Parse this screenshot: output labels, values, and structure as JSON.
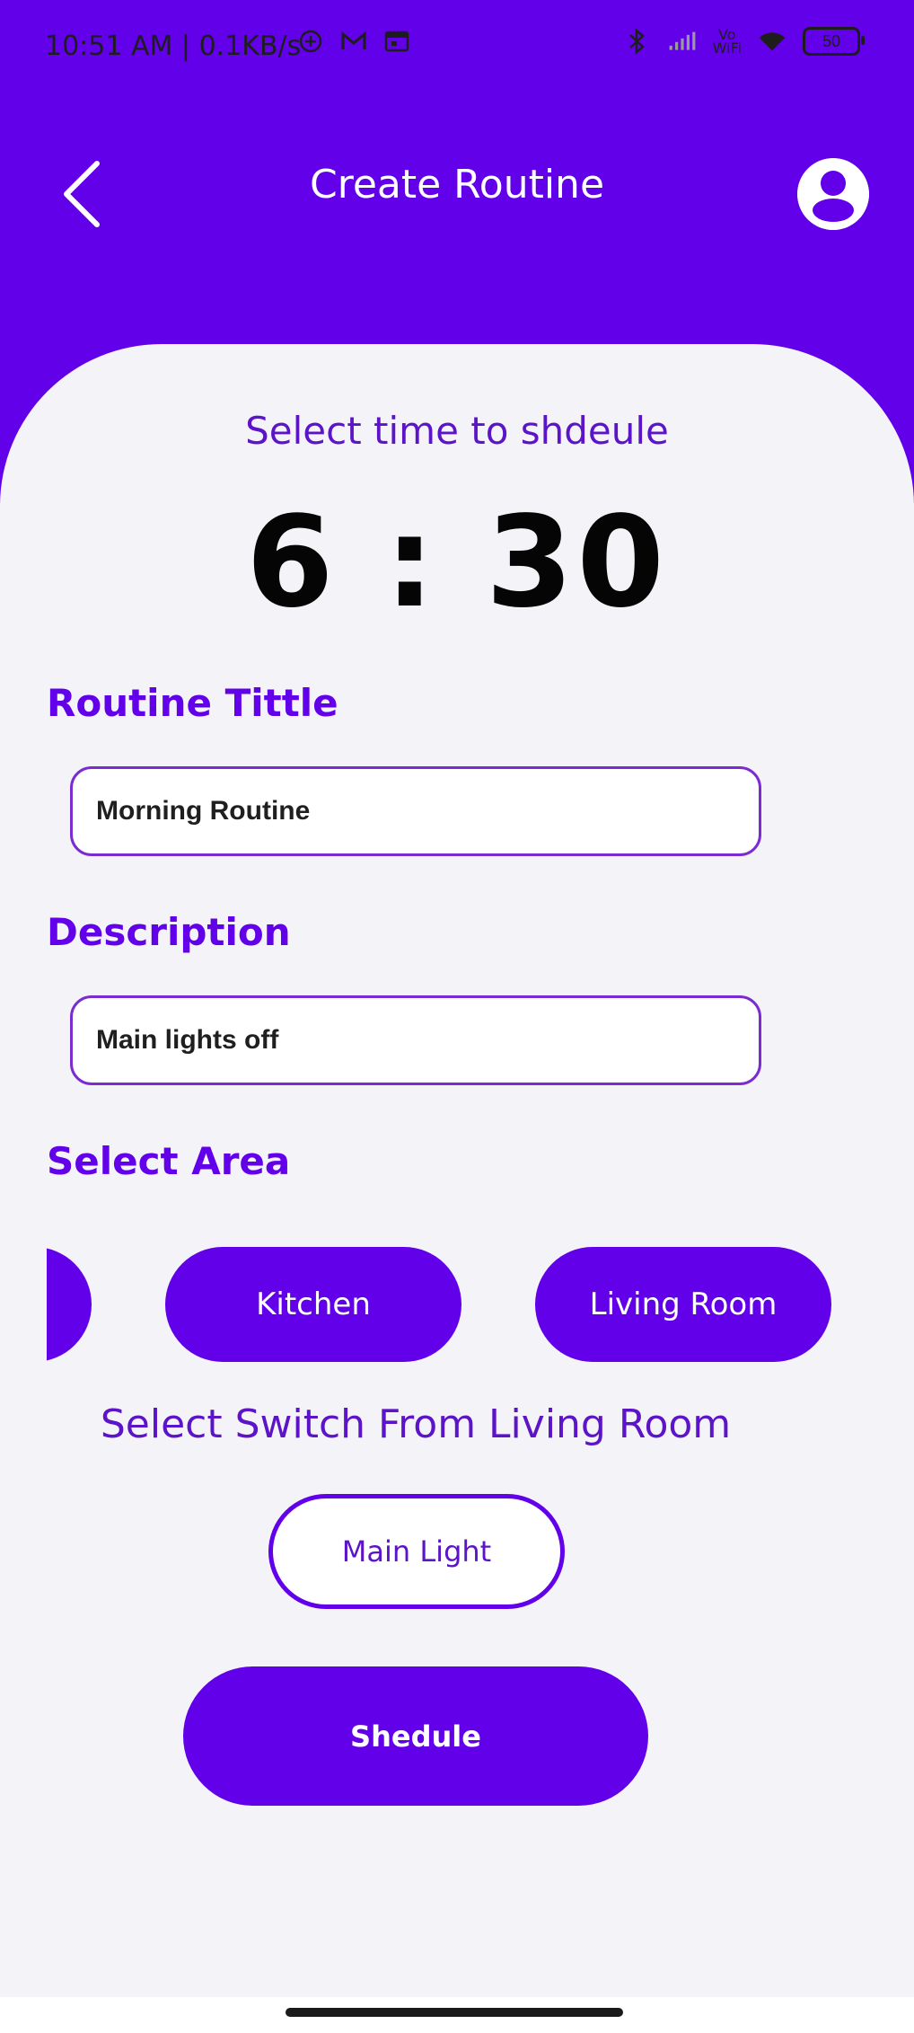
{
  "status_bar": {
    "time": "10:51 AM | 0.1KB/s",
    "vowifi_top": "Vo",
    "vowifi_bottom": "WiFi",
    "battery": "50"
  },
  "header": {
    "title": "Create Routine"
  },
  "schedule": {
    "prompt": "Select time to shdeule",
    "time": "6 : 30"
  },
  "routine_title": {
    "label": "Routine Tittle",
    "value": "Morning Routine"
  },
  "description": {
    "label": "Description",
    "value": "Main lights off"
  },
  "area": {
    "label": "Select Area",
    "chips": [
      "",
      "Kitchen",
      "Living Room"
    ]
  },
  "switches": {
    "prompt": "Select Switch From Living Room",
    "items": [
      "Main Light"
    ]
  },
  "actions": {
    "schedule_label": "Shedule"
  },
  "colors": {
    "primary": "#6200ea",
    "accent_text": "#5b14c7",
    "background": "#f4f3f8"
  }
}
